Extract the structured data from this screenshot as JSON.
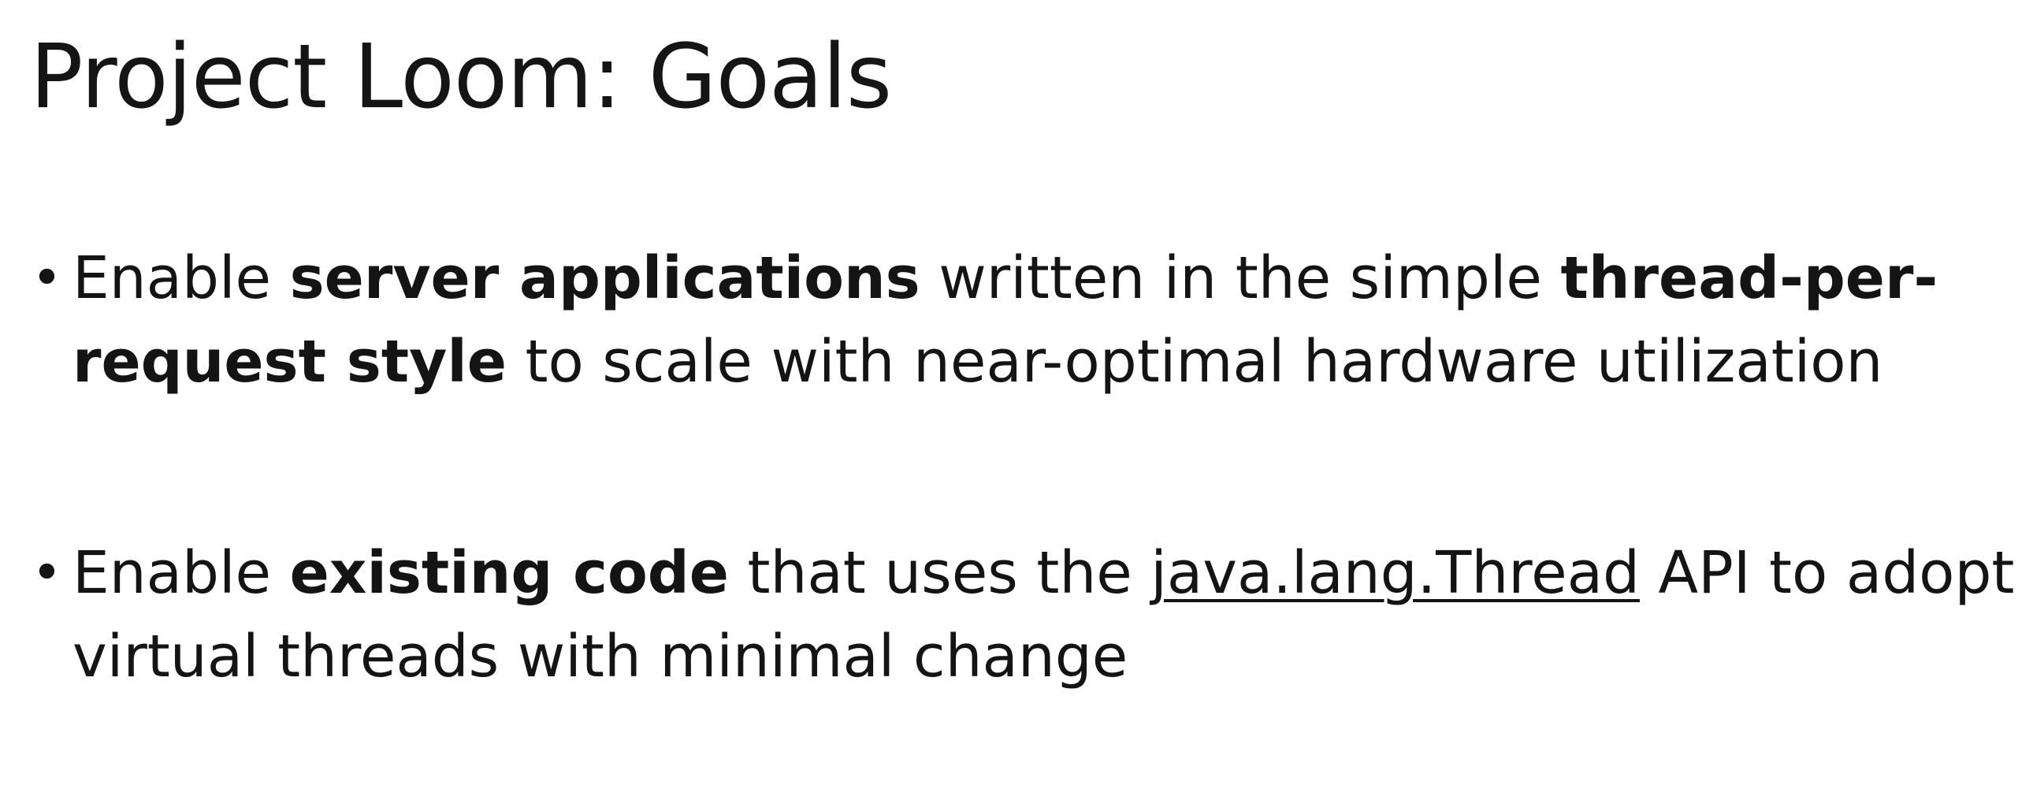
{
  "slide": {
    "title": "Project Loom: Goals",
    "bullet_glyph": "•",
    "bullets": [
      {
        "segments": [
          {
            "text": "Enable ",
            "style": "normal"
          },
          {
            "text": "server applications",
            "style": "bold"
          },
          {
            "text": " written in the simple ",
            "style": "normal"
          },
          {
            "text": "thread-per-request style",
            "style": "bold"
          },
          {
            "text": " to scale with near-optimal hardware utilization",
            "style": "normal"
          }
        ]
      },
      {
        "segments": [
          {
            "text": "Enable ",
            "style": "normal"
          },
          {
            "text": "existing code",
            "style": "bold"
          },
          {
            "text": " that uses the ",
            "style": "normal"
          },
          {
            "text": "java.lang.Thread",
            "style": "underline"
          },
          {
            "text": " API to adopt virtual threads with minimal change",
            "style": "normal"
          }
        ]
      }
    ]
  }
}
